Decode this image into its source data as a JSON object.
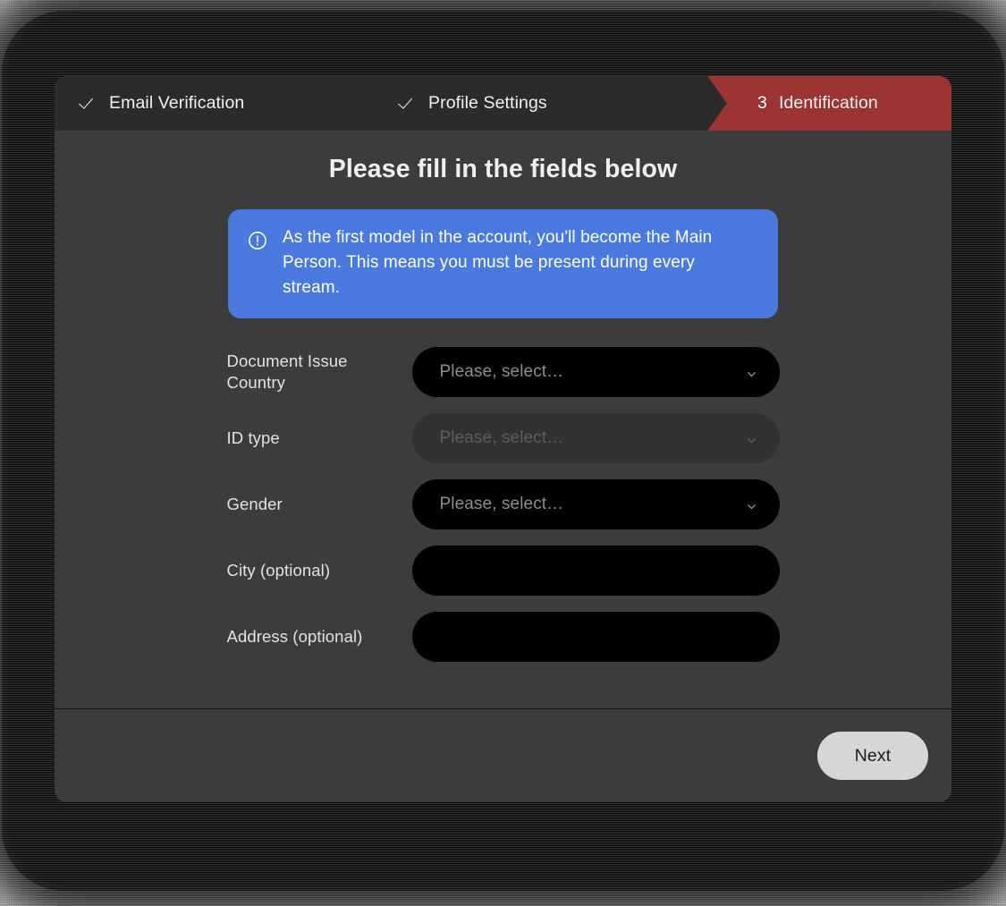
{
  "stepper": {
    "steps": [
      {
        "label": "Email Verification",
        "state": "completed",
        "marker": "check",
        "icon": "check-icon"
      },
      {
        "label": "Profile Settings",
        "state": "completed",
        "marker": "check",
        "icon": "check-icon"
      },
      {
        "label": "Identification",
        "state": "active",
        "marker": "3",
        "number": "3"
      }
    ]
  },
  "main": {
    "title": "Please fill in the fields below",
    "banner": {
      "icon": "exclamation-circle-icon",
      "color": "#4a7ae0",
      "text": "As the first model in the account, you'll become the Main Person. This means you must be present during every stream."
    },
    "fields": [
      {
        "label": "Document Issue Country",
        "type": "select",
        "value": "Please, select…",
        "placeholder": "Please, select…",
        "disabled": false,
        "icon": "chevron-down-icon"
      },
      {
        "label": "ID type",
        "type": "select",
        "value": "Please, select…",
        "placeholder": "Please, select…",
        "disabled": true,
        "icon": "chevron-down-icon"
      },
      {
        "label": "Gender",
        "type": "select",
        "value": "Please, select…",
        "placeholder": "Please, select…",
        "disabled": false,
        "icon": "chevron-down-icon"
      },
      {
        "label": "City (optional)",
        "type": "text",
        "value": "",
        "placeholder": "",
        "disabled": false
      },
      {
        "label": "Address (optional)",
        "type": "text",
        "value": "",
        "placeholder": "",
        "disabled": false
      }
    ]
  },
  "footer": {
    "next_label": "Next"
  },
  "colors": {
    "accent_red": "#9c3434",
    "banner_blue": "#4a7ae0",
    "modal_bg": "#3c3c3c",
    "header_bg": "#2b2b2b",
    "field_bg": "#000000",
    "button_bg": "#d6d6d6"
  }
}
